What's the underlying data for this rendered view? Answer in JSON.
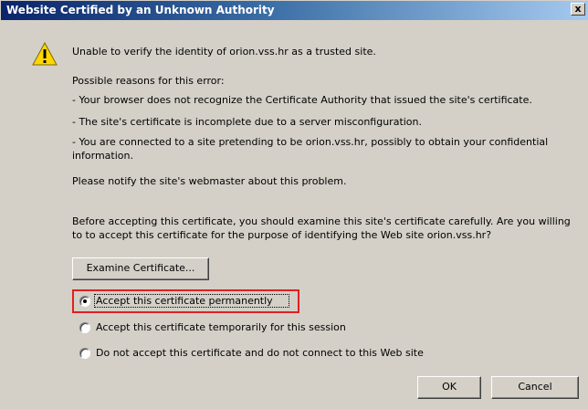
{
  "window": {
    "title": "Website Certified by an Unknown Authority",
    "close_label": "x"
  },
  "message": {
    "line1": "Unable to verify the identity of orion.vss.hr as a trusted site.",
    "reasons_heading": "Possible reasons for this error:",
    "reason1": "- Your browser does not recognize the Certificate Authority that issued the site's certificate.",
    "reason2": "- The site's certificate is incomplete due to a server misconfiguration.",
    "reason3": "- You are connected to a site pretending to be orion.vss.hr, possibly to obtain your confidential information.",
    "notify": "Please notify the site's webmaster about this problem.",
    "before_accepting": "Before accepting this certificate, you should examine this site's certificate carefully. Are you willing to to accept this certificate for the purpose of identifying the Web site orion.vss.hr?"
  },
  "buttons": {
    "examine": "Examine Certificate...",
    "ok": "OK",
    "cancel": "Cancel"
  },
  "options": [
    {
      "label": "Accept this certificate permanently",
      "selected": true
    },
    {
      "label": "Accept this certificate temporarily for this session",
      "selected": false
    },
    {
      "label": "Do not accept this certificate and do not connect to this Web site",
      "selected": false
    }
  ],
  "colors": {
    "dialog_bg": "#d4d0c8",
    "titlebar_start": "#0a246a",
    "titlebar_end": "#a6caf0",
    "highlight_border": "#e02020",
    "warning_yellow": "#ffd700"
  },
  "icons": {
    "warning": "warning-icon",
    "close": "close-icon"
  }
}
